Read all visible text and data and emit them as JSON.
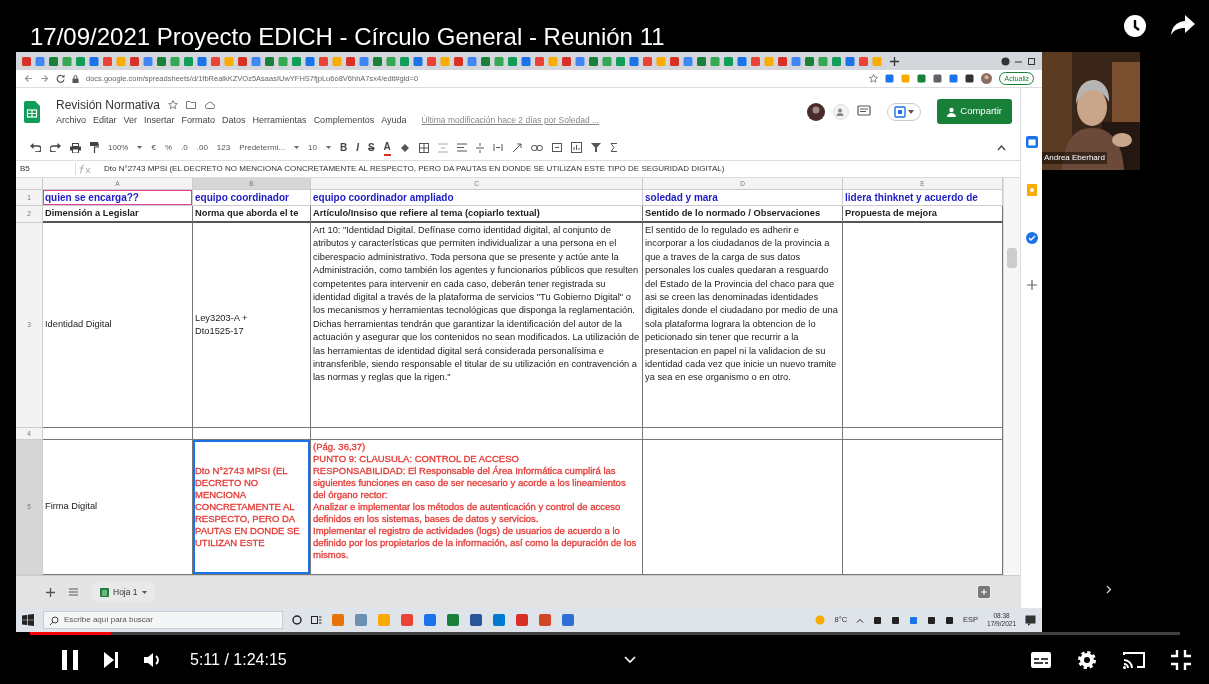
{
  "video": {
    "title": "17/09/2021 Proyecto EDICH - Círculo General - Reunión 11"
  },
  "browser": {
    "url": "docs.google.com/spreadsheets/d/1fbRealkKZVOz5AsaasIUwYFHS7fjpLu6o8V6hhA7sx4/edit#gid=0",
    "update_button": "Actualiz"
  },
  "sheet": {
    "title": "Revisión Normativa",
    "menu": [
      "Archivo",
      "Editar",
      "Ver",
      "Insertar",
      "Formato",
      "Datos",
      "Herramientas",
      "Complementos",
      "Ayuda"
    ],
    "last_edit": "Última modificación hace 2 días por Soledad ...",
    "share_button": "Compartir",
    "toolbar": {
      "zoom": "100%",
      "currency": "€",
      "percent": "%",
      "decimal_less": ".0",
      "decimal_more": ".00",
      "number_format": "123",
      "font": "Predetermi...",
      "font_size": "10",
      "format_buttons": [
        "B",
        "I",
        "S",
        "A"
      ]
    },
    "name_box": "B5",
    "formula": "Dto N°2743 MPSI  (EL DECRETO NO MENCIONA CONCRETAMENTE AL RESPECTO, PERO DA PAUTAS EN DONDE SE UTILIZAN ESTE TIPO DE SEGURIDAD DIGITAL)",
    "columns": [
      {
        "label": "A",
        "selected": false
      },
      {
        "label": "B",
        "selected": true
      },
      {
        "label": "C",
        "selected": false
      },
      {
        "label": "D",
        "selected": false
      },
      {
        "label": "E",
        "selected": false
      }
    ],
    "rows": [
      {
        "number": "1",
        "selected": false,
        "kind": "owner",
        "cells": [
          {
            "text": "quien se encarga??",
            "selected": false,
            "outlined": true
          },
          {
            "text": "equipo coordinador",
            "selected": false,
            "outlined": false
          },
          {
            "text": "equipo coordinador ampliado",
            "selected": false,
            "outlined": false
          },
          {
            "text": "soledad y mara",
            "selected": false,
            "outlined": false
          },
          {
            "text": "lidera thinknet y acuerdo de",
            "selected": false,
            "outlined": false
          }
        ]
      },
      {
        "number": "2",
        "selected": false,
        "kind": "header",
        "cells": [
          {
            "text": "Dimensión a Legislar",
            "selected": false,
            "outlined": false
          },
          {
            "text": "Norma que aborda el te",
            "selected": false,
            "outlined": false
          },
          {
            "text": "Artículo/Insiso que refiere al tema (copiarlo textual)",
            "selected": false,
            "outlined": false
          },
          {
            "text": "Sentido de lo normado / Observaciones",
            "selected": false,
            "outlined": false
          },
          {
            "text": "Propuesta de mejora",
            "selected": false,
            "outlined": false
          }
        ]
      },
      {
        "number": "3",
        "selected": false,
        "kind": "body",
        "cells": [
          {
            "text": "Identidad Digital",
            "selected": false,
            "outlined": false
          },
          {
            "text": "Ley3203-A +\nDto1525-17",
            "selected": false,
            "outlined": false
          },
          {
            "text": "Art 10: \"Identidad Digital. Defínase como identidad digital, al conjunto de atributos y características que permiten individualizar a una persona en el ciberespacio administrativo. Toda persona que se presente y actúe ante la Administración, como también los agentes y funcionarios públicos que resulten competentes para intervenir en cada caso, deberán tener registrada su identidad digital a través de la plataforma de servicios \"Tu Gobierno Digital\" o los mecanismos y herramientas tecnológicas que disponga la reglamentación. Dichas herramientas tendrán que garantizar la identificación del autor de la actuación y asegurar que los contenidos no sean modificados. La utilización de las herramientas de identidad digital será considerada personalísima e intransferible, siendo responsable el titular de su utilización en contravención a las normas y reglas que la rigen.\"",
            "selected": false,
            "outlined": false
          },
          {
            "text": "El sentido de lo regulado es adherir e incorporar a los ciudadanos de la provincia a que a traves de la carga de sus datos personales los cuales quedaran a resguardo del Estado de la Provincia del chaco para que asi se creen las denominadas identidades digitales donde el ciudadano por medio de una sola plataforma lograra la obtencion de lo peticionado sin tener que recurrir a la presentacion en papel ni la validacion de su identidad cada vez que inicie un nuevo tramite ya sea en ese organismo o en otro.",
            "selected": false,
            "outlined": false
          },
          {
            "selected": false,
            "outlined": false
          }
        ]
      },
      {
        "number": "4",
        "selected": false,
        "kind": "body",
        "cells": [
          {
            "selected": false,
            "outlined": false
          },
          {
            "selected": false,
            "outlined": false
          },
          {
            "selected": false,
            "outlined": false
          },
          {
            "selected": false,
            "outlined": false
          },
          {
            "selected": false,
            "outlined": false
          }
        ]
      },
      {
        "number": "5",
        "selected": true,
        "kind": "body",
        "cells": [
          {
            "text": "Firma Digital",
            "selected": false,
            "outlined": false
          },
          {
            "text": "Dto N°2743 MPSI  (EL DECRETO NO MENCIONA CONCRETAMENTE AL RESPECTO, PERO DA PAUTAS EN DONDE SE UTILIZAN ESTE",
            "selected": true,
            "outlined": false,
            "color": "#e53935"
          },
          {
            "text": "(Pág. 36,37)\nPUNTO 9: CLAUSULA: CONTROL DE ACCESO\nRESPONSABILIDAD: El Responsable del Área Informática cumplirá las siguientes funciones en caso de ser necesario y acorde a los lineamientos del órgano rector:\n  Analizar e implementar los métodos de autenticación y control de acceso definidos en los sistemas, bases de datos y servicios.\n  Implementar el registro de actividades (logs) de usuarios de acuerdo a lo definido por los propietarios de la información, así como la depuración de los mismos.",
            "selected": false,
            "outlined": false,
            "color": "#e53935"
          },
          {
            "selected": false,
            "outlined": false
          },
          {
            "selected": false,
            "outlined": false
          }
        ]
      }
    ],
    "sheet_tab": "Hoja 1"
  },
  "webcam": {
    "name": "Andrea Eberhard"
  },
  "taskbar": {
    "search_placeholder": "Escribe aquí para buscar",
    "weather": "8°C",
    "language": "ESP",
    "time": "08:38",
    "date": "17/9/2021"
  },
  "player": {
    "level": 0.07,
    "time": "5:11 / 1:24:15"
  }
}
